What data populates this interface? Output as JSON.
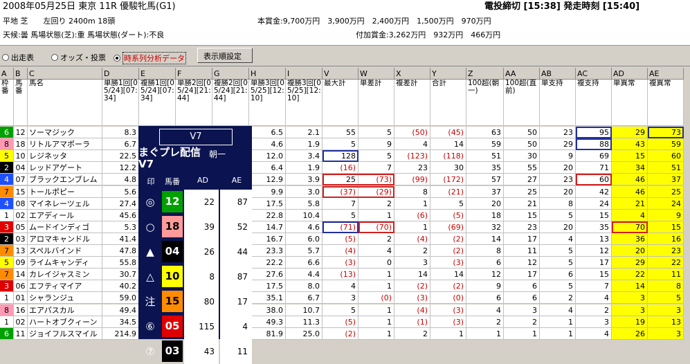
{
  "header": {
    "race_title": "2008年05月25日 東京 11R 優駿牝馬(G1)",
    "course": "平地 芝　　左回り 2400m 18頭",
    "weather": "天候:曇 馬場状態(芝):重 馬場状態(ダート):不良",
    "prize": "本賞金:9,700万円　3,900万円　2,400万円　1,500万円　970万円",
    "add_prize": "付加賞金:3,262万円　932万円　466万円",
    "deadline": "電投締切 [15:38] 発走時刻 [15:40]"
  },
  "toolbar": {
    "radio1": "出走表",
    "radio2": "オッズ・投票",
    "radio3": "時系列分析データ",
    "settings": "表示順設定"
  },
  "columns": {
    "letters": [
      "A",
      "B",
      "C",
      "D",
      "E",
      "F",
      "G",
      "H",
      "I",
      "V",
      "W",
      "X",
      "Y",
      "Z",
      "AA",
      "AB",
      "AC",
      "AD",
      "AE"
    ],
    "labels": [
      "枠番",
      "馬番",
      "馬名",
      "単勝1回[05/24][07:34]",
      "複勝1回[05/24][07:34]",
      "単勝2回[05/24][21:44]",
      "複勝2回[05/24][21:44]",
      "単勝3回[05/25][12:10]",
      "複勝3回[05/25][12:10]",
      "最大計",
      "単差計",
      "複差計",
      "合計",
      "100超(朝一)",
      "100超(直前)",
      "単支持",
      "複支持",
      "単異常",
      "複異常"
    ]
  },
  "rows": [
    {
      "waku": "6",
      "uma": "12",
      "name": "ソーマジック",
      "d": "8.3",
      "e": "",
      "f": "",
      "g": "",
      "h": "6.5",
      "i": "2.1",
      "v": "55",
      "w": "5",
      "x": "(50)",
      "y": "(45)",
      "z": "63",
      "aa": "50",
      "ab": "23",
      "ac": "95",
      "ad": "29",
      "ae": "73"
    },
    {
      "waku": "8",
      "uma": "18",
      "name": "リトルアマポーラ",
      "d": "6.7",
      "e": "",
      "f": "",
      "g": "",
      "h": "4.6",
      "i": "1.9",
      "v": "5",
      "w": "9",
      "x": "4",
      "y": "14",
      "z": "59",
      "aa": "50",
      "ab": "29",
      "ac": "88",
      "ad": "43",
      "ae": "59"
    },
    {
      "waku": "5",
      "uma": "10",
      "name": "レジネッタ",
      "d": "22.5",
      "e": "",
      "f": "",
      "g": "",
      "h": "12.0",
      "i": "3.4",
      "v": "128",
      "w": "5",
      "x": "(123)",
      "y": "(118)",
      "z": "51",
      "aa": "30",
      "ab": "9",
      "ac": "69",
      "ad": "15",
      "ae": "60"
    },
    {
      "waku": "2",
      "uma": "04",
      "name": "レッドアゲート",
      "d": "12.2",
      "e": "",
      "f": "",
      "g": "",
      "h": "6.4",
      "i": "1.9",
      "v": "(16)",
      "w": "7",
      "x": "23",
      "y": "30",
      "z": "35",
      "aa": "55",
      "ab": "20",
      "ac": "71",
      "ad": "34",
      "ae": "51"
    },
    {
      "waku": "4",
      "uma": "07",
      "name": "ブラックエンブレム",
      "d": "4.8",
      "e": "",
      "f": "",
      "g": "",
      "h": "12.9",
      "i": "3.9",
      "v": "25",
      "w": "(73)",
      "x": "(99)",
      "y": "(172)",
      "z": "57",
      "aa": "27",
      "ab": "23",
      "ac": "60",
      "ad": "46",
      "ae": "37"
    },
    {
      "waku": "7",
      "uma": "15",
      "name": "トールポピー",
      "d": "5.6",
      "e": "",
      "f": "",
      "g": "",
      "h": "9.9",
      "i": "3.0",
      "v": "(37)",
      "w": "(29)",
      "x": "8",
      "y": "(21)",
      "z": "37",
      "aa": "25",
      "ab": "20",
      "ac": "42",
      "ad": "46",
      "ae": "25"
    },
    {
      "waku": "4",
      "uma": "08",
      "name": "マイネレーツェル",
      "d": "27.4",
      "e": "",
      "f": "",
      "g": "",
      "h": "17.5",
      "i": "5.8",
      "v": "7",
      "w": "2",
      "x": "1",
      "y": "5",
      "z": "20",
      "aa": "21",
      "ab": "8",
      "ac": "24",
      "ad": "21",
      "ae": "24"
    },
    {
      "waku": "1",
      "uma": "02",
      "name": "エアディール",
      "d": "45.6",
      "e": "",
      "f": "",
      "g": "",
      "h": "22.8",
      "i": "10.4",
      "v": "5",
      "w": "1",
      "x": "(6)",
      "y": "(5)",
      "z": "18",
      "aa": "15",
      "ab": "5",
      "ac": "15",
      "ad": "4",
      "ae": "9"
    },
    {
      "waku": "3",
      "uma": "05",
      "name": "ムードインディゴ",
      "d": "5.3",
      "e": "",
      "f": "",
      "g": "",
      "h": "14.7",
      "i": "4.6",
      "v": "(71)",
      "w": "(70)",
      "x": "1",
      "y": "(69)",
      "z": "32",
      "aa": "23",
      "ab": "20",
      "ac": "35",
      "ad": "70",
      "ae": "15"
    },
    {
      "waku": "2",
      "uma": "03",
      "name": "アロマキャンドル",
      "d": "41.4",
      "e": "",
      "f": "",
      "g": "",
      "h": "16.7",
      "i": "6.0",
      "v": "(5)",
      "w": "2",
      "x": "(4)",
      "y": "(2)",
      "z": "14",
      "aa": "17",
      "ab": "4",
      "ac": "13",
      "ad": "36",
      "ae": "16"
    },
    {
      "waku": "7",
      "uma": "13",
      "name": "スペルバインド",
      "d": "47.8",
      "e": "",
      "f": "",
      "g": "",
      "h": "23.3",
      "i": "5.7",
      "v": "(4)",
      "w": "4",
      "x": "2",
      "y": "(2)",
      "z": "8",
      "aa": "11",
      "ab": "5",
      "ac": "12",
      "ad": "20",
      "ae": "23"
    },
    {
      "waku": "5",
      "uma": "09",
      "name": "ライムキャンディ",
      "d": "55.8",
      "e": "",
      "f": "",
      "g": "",
      "h": "22.2",
      "i": "6.6",
      "v": "(3)",
      "w": "0",
      "x": "3",
      "y": "(3)",
      "z": "6",
      "aa": "12",
      "ab": "5",
      "ac": "17",
      "ad": "29",
      "ae": "22"
    },
    {
      "waku": "7",
      "uma": "14",
      "name": "カレイジャスミン",
      "d": "30.7",
      "e": "",
      "f": "",
      "g": "",
      "h": "27.6",
      "i": "4.4",
      "v": "(13)",
      "w": "1",
      "x": "14",
      "y": "14",
      "z": "12",
      "aa": "17",
      "ab": "6",
      "ac": "15",
      "ad": "22",
      "ae": "11"
    },
    {
      "waku": "3",
      "uma": "06",
      "name": "エフティマイア",
      "d": "40.2",
      "e": "",
      "f": "",
      "g": "",
      "h": "17.5",
      "i": "8.0",
      "v": "4",
      "w": "1",
      "x": "(2)",
      "y": "(2)",
      "z": "9",
      "aa": "6",
      "ab": "5",
      "ac": "7",
      "ad": "14",
      "ae": "8"
    },
    {
      "waku": "1",
      "uma": "01",
      "name": "シャランジュ",
      "d": "59.0",
      "e": "",
      "f": "",
      "g": "",
      "h": "35.1",
      "i": "6.7",
      "v": "3",
      "w": "(0)",
      "x": "(3)",
      "y": "(0)",
      "z": "6",
      "aa": "6",
      "ab": "2",
      "ac": "4",
      "ad": "3",
      "ae": "5"
    },
    {
      "waku": "8",
      "uma": "16",
      "name": "エアパスカル",
      "d": "49.4",
      "e": "",
      "f": "",
      "g": "",
      "h": "38.0",
      "i": "10.7",
      "v": "5",
      "w": "1",
      "x": "(4)",
      "y": "(3)",
      "z": "4",
      "aa": "3",
      "ab": "4",
      "ac": "2",
      "ad": "3",
      "ae": "3"
    },
    {
      "waku": "1",
      "uma": "02",
      "name": "ハートオブクィーン",
      "d": "34.5",
      "e": "",
      "f": "",
      "g": "",
      "h": "49.3",
      "i": "11.3",
      "v": "(5)",
      "w": "1",
      "x": "(1)",
      "y": "(3)",
      "z": "2",
      "aa": "2",
      "ab": "1",
      "ac": "3",
      "ad": "19",
      "ae": "13"
    },
    {
      "waku": "6",
      "uma": "11",
      "name": "ジョイフルスマイル",
      "d": "214.9",
      "e": "",
      "f": "",
      "g": "",
      "h": "81.9",
      "i": "25.0",
      "v": "(2)",
      "w": "1",
      "x": "2",
      "y": "1",
      "z": "1",
      "aa": "1",
      "ab": "1",
      "ac": "4",
      "ad": "26",
      "ae": "3"
    }
  ],
  "popup": {
    "title": "V7",
    "banner": "まぐプレ配信 V7",
    "extra": "朝一",
    "head_mark": "印",
    "head_uma": "馬番",
    "head_ad": "AD",
    "head_ae": "AE",
    "rows": [
      {
        "mark": "◎",
        "uma": "12",
        "ad": "22",
        "ae": "87",
        "color": "#00a000",
        "fg": "#ffffff"
      },
      {
        "mark": "○",
        "uma": "18",
        "ad": "39",
        "ae": "52",
        "color": "#ff9a9a",
        "fg": "#000000"
      },
      {
        "mark": "▲",
        "uma": "04",
        "ad": "26",
        "ae": "44",
        "color": "#000000",
        "fg": "#ffffff"
      },
      {
        "mark": "△",
        "uma": "10",
        "ad": "8",
        "ae": "87",
        "color": "#ffff00",
        "fg": "#000000"
      },
      {
        "mark": "注",
        "uma": "15",
        "ad": "80",
        "ae": "17",
        "color": "#ff8c00",
        "fg": "#000000"
      },
      {
        "mark": "⑥",
        "uma": "05",
        "ad": "115",
        "ae": "4",
        "color": "#e00000",
        "fg": "#ffffff"
      },
      {
        "mark": "⑦",
        "uma": "03",
        "ad": "43",
        "ae": "11",
        "color": "#000000",
        "fg": "#ffffff"
      }
    ]
  },
  "colors": {
    "waku": {
      "1": "#ffffff",
      "2": "#000000",
      "3": "#e00000",
      "4": "#1e50ff",
      "5": "#ffff00",
      "6": "#00a000",
      "7": "#ff8c00",
      "8": "#ff9ab4"
    },
    "waku_fg": {
      "1": "#000000",
      "2": "#ffffff",
      "3": "#ffffff",
      "4": "#ffffff",
      "5": "#000000",
      "6": "#ffffff",
      "7": "#000000",
      "8": "#000000"
    }
  }
}
